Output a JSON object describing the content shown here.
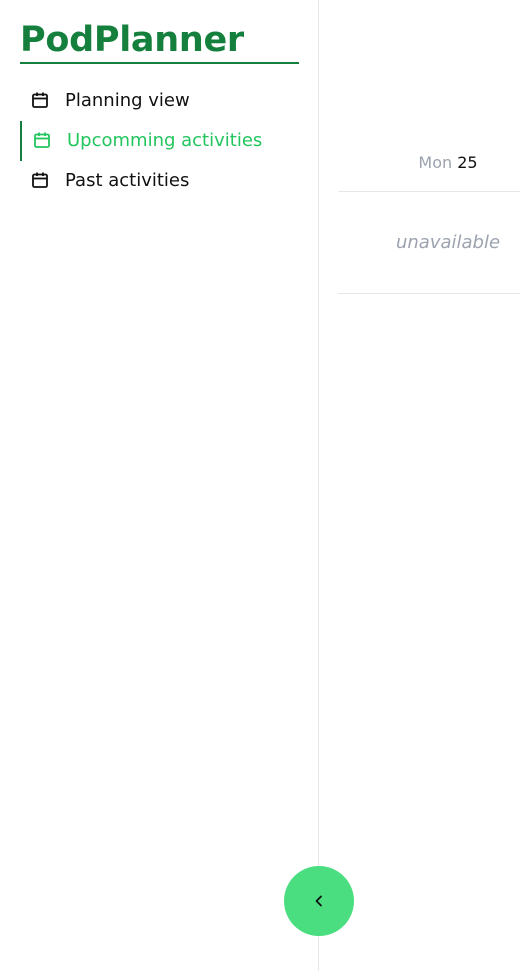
{
  "brand": {
    "title": "PodPlanner"
  },
  "sidebar": {
    "items": [
      {
        "label": "Planning view",
        "icon": "calendar-icon",
        "active": false
      },
      {
        "label": "Upcomming activities",
        "icon": "calendar-icon",
        "active": true
      },
      {
        "label": "Past activities",
        "icon": "calendar-icon",
        "active": false
      }
    ]
  },
  "calendar": {
    "day": {
      "name": "Mon",
      "number": "25"
    },
    "status": "unavailable"
  },
  "collapse_button": {
    "icon": "chevron-left-icon"
  },
  "colors": {
    "brand": "#15803d",
    "active": "#22c55e",
    "fab": "#4ade80",
    "muted": "#9ca3af",
    "border": "#e5e7eb"
  }
}
